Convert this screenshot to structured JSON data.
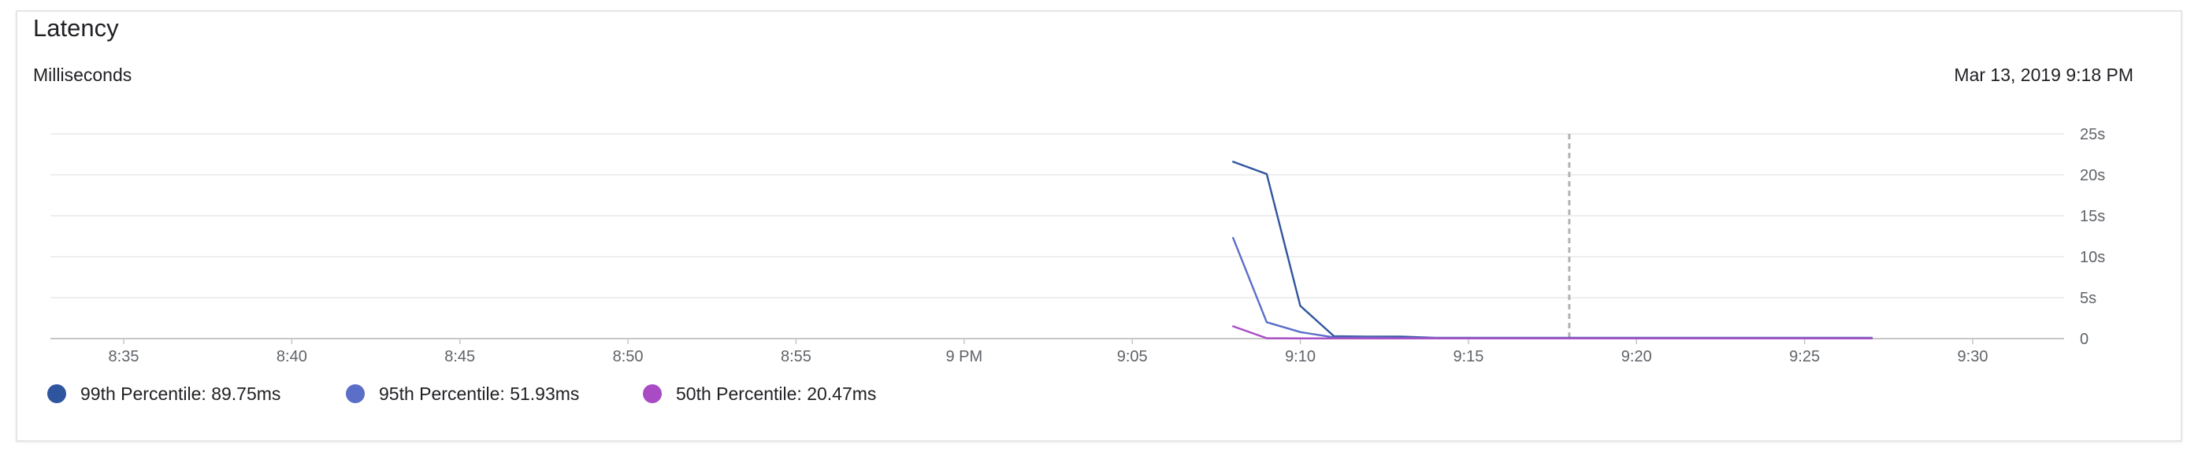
{
  "card": {
    "title": "Latency",
    "unit_label": "Milliseconds",
    "timestamp": "Mar 13, 2019 9:18 PM"
  },
  "legend": [
    {
      "label": "99th Percentile: 89.75ms",
      "color": "#2f559f"
    },
    {
      "label": "95th Percentile: 51.93ms",
      "color": "#5b6ec8"
    },
    {
      "label": "50th Percentile: 20.47ms",
      "color": "#a94bc4"
    }
  ],
  "chart_data": {
    "type": "line",
    "x_unit": "minutes",
    "x_ticks": [
      {
        "t": "8:35",
        "label": "8:35"
      },
      {
        "t": "8:40",
        "label": "8:40"
      },
      {
        "t": "8:45",
        "label": "8:45"
      },
      {
        "t": "8:50",
        "label": "8:50"
      },
      {
        "t": "8:55",
        "label": "8:55"
      },
      {
        "t": "9:00",
        "label": "9 PM"
      },
      {
        "t": "9:05",
        "label": "9:05"
      },
      {
        "t": "9:10",
        "label": "9:10"
      },
      {
        "t": "9:15",
        "label": "9:15"
      },
      {
        "t": "9:20",
        "label": "9:20"
      },
      {
        "t": "9:25",
        "label": "9:25"
      },
      {
        "t": "9:30",
        "label": "9:30"
      }
    ],
    "xlim": [
      "8:33",
      "9:33"
    ],
    "y_ticks": [
      {
        "value": 0,
        "label": "0"
      },
      {
        "value": 5,
        "label": "5s"
      },
      {
        "value": 10,
        "label": "10s"
      },
      {
        "value": 15,
        "label": "15s"
      },
      {
        "value": 20,
        "label": "20s"
      },
      {
        "value": 25,
        "label": "25s"
      }
    ],
    "ylim": [
      0,
      25
    ],
    "y_unit": "seconds",
    "grid": true,
    "cursor_time": "9:18",
    "series": [
      {
        "name": "99th Percentile",
        "color": "#2f559f",
        "points": [
          [
            "9:08",
            21.6
          ],
          [
            "9:09",
            20.1
          ],
          [
            "9:10",
            4.0
          ],
          [
            "9:11",
            0.3
          ],
          [
            "9:12",
            0.25
          ],
          [
            "9:13",
            0.25
          ],
          [
            "9:14",
            0.1
          ],
          [
            "9:15",
            0.1
          ],
          [
            "9:16",
            0.1
          ],
          [
            "9:17",
            0.1
          ],
          [
            "9:18",
            0.1
          ],
          [
            "9:19",
            0.1
          ],
          [
            "9:20",
            0.1
          ],
          [
            "9:21",
            0.1
          ],
          [
            "9:22",
            0.1
          ],
          [
            "9:23",
            0.1
          ],
          [
            "9:24",
            0.1
          ],
          [
            "9:25",
            0.1
          ],
          [
            "9:26",
            0.1
          ],
          [
            "9:27",
            0.1
          ]
        ]
      },
      {
        "name": "95th Percentile",
        "color": "#5b6ec8",
        "points": [
          [
            "9:08",
            12.3
          ],
          [
            "9:09",
            2.0
          ],
          [
            "9:10",
            0.8
          ],
          [
            "9:11",
            0.15
          ],
          [
            "9:12",
            0.15
          ],
          [
            "9:13",
            0.1
          ],
          [
            "9:14",
            0.08
          ],
          [
            "9:15",
            0.08
          ],
          [
            "9:16",
            0.08
          ],
          [
            "9:17",
            0.08
          ],
          [
            "9:18",
            0.08
          ],
          [
            "9:19",
            0.08
          ],
          [
            "9:20",
            0.08
          ],
          [
            "9:21",
            0.08
          ],
          [
            "9:22",
            0.08
          ],
          [
            "9:23",
            0.08
          ],
          [
            "9:24",
            0.08
          ],
          [
            "9:25",
            0.08
          ],
          [
            "9:26",
            0.08
          ],
          [
            "9:27",
            0.08
          ]
        ]
      },
      {
        "name": "50th Percentile",
        "color": "#a94bc4",
        "points": [
          [
            "9:08",
            1.5
          ],
          [
            "9:09",
            0.05
          ],
          [
            "9:10",
            0.03
          ],
          [
            "9:11",
            0.03
          ],
          [
            "9:12",
            0.03
          ],
          [
            "9:13",
            0.03
          ],
          [
            "9:14",
            0.03
          ],
          [
            "9:15",
            0.03
          ],
          [
            "9:16",
            0.03
          ],
          [
            "9:17",
            0.03
          ],
          [
            "9:18",
            0.03
          ],
          [
            "9:19",
            0.03
          ],
          [
            "9:20",
            0.03
          ],
          [
            "9:21",
            0.03
          ],
          [
            "9:22",
            0.03
          ],
          [
            "9:23",
            0.03
          ],
          [
            "9:24",
            0.03
          ],
          [
            "9:25",
            0.03
          ],
          [
            "9:26",
            0.03
          ],
          [
            "9:27",
            0.03
          ]
        ]
      }
    ]
  }
}
